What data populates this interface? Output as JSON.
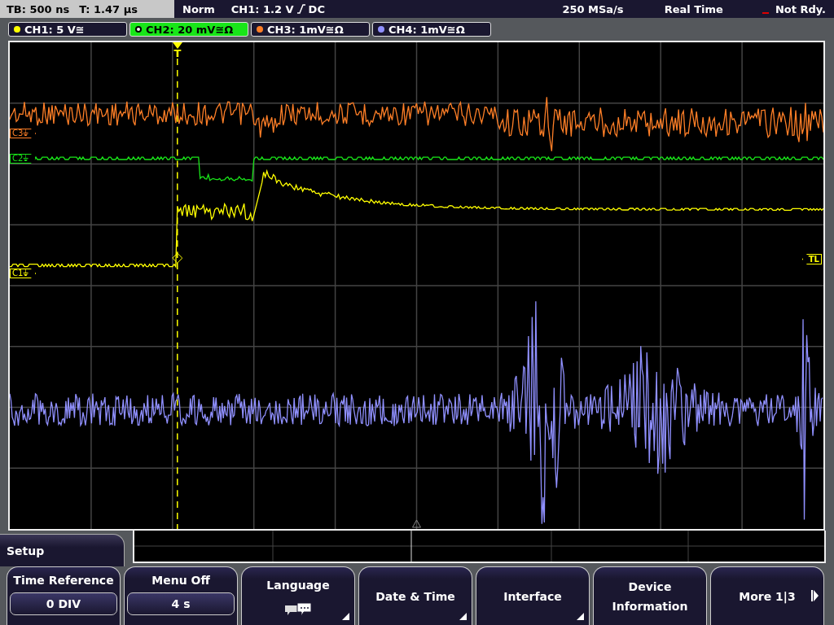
{
  "status_bar": {
    "timebase": "TB: 500 ns",
    "trigger_time": "T: 1.47 µs",
    "mode": "Norm",
    "trigger_level": "CH1: 1.2 V",
    "coupling": "DC",
    "sample_rate": "250 MSa/s",
    "acquisition": "Real Time",
    "state": "Not Rdy."
  },
  "channels": [
    {
      "label": "CH1: 5 V≅",
      "color": "#ffff00",
      "selected": false
    },
    {
      "label": "CH2: 20 mV≅Ω",
      "color": "#19e619",
      "selected": true
    },
    {
      "label": "CH3: 1mV≅Ω",
      "color": "#ff7f27",
      "selected": false
    },
    {
      "label": "CH4: 1mV≅Ω",
      "color": "#9090ff",
      "selected": false
    }
  ],
  "plot_markers": [
    {
      "label": "C3⏚",
      "color": "#ff7f27"
    },
    {
      "label": "C2⏚",
      "color": "#19e619"
    },
    {
      "label": "C1⏚",
      "color": "#ffff00"
    }
  ],
  "trigger_marker": "T",
  "trigger_level_marker": "TL",
  "menu": {
    "title": "Setup",
    "softkeys": [
      {
        "kind": "value",
        "label": "Time Reference",
        "value": "0 DIV"
      },
      {
        "kind": "value",
        "label": "Menu Off",
        "value": "4 s"
      },
      {
        "kind": "icon",
        "label": "Language"
      },
      {
        "kind": "submenu",
        "label": "Date & Time"
      },
      {
        "kind": "submenu",
        "label": "Interface"
      },
      {
        "kind": "plain",
        "label": "Device Information"
      },
      {
        "kind": "next",
        "label": "More 1|3"
      }
    ]
  }
}
